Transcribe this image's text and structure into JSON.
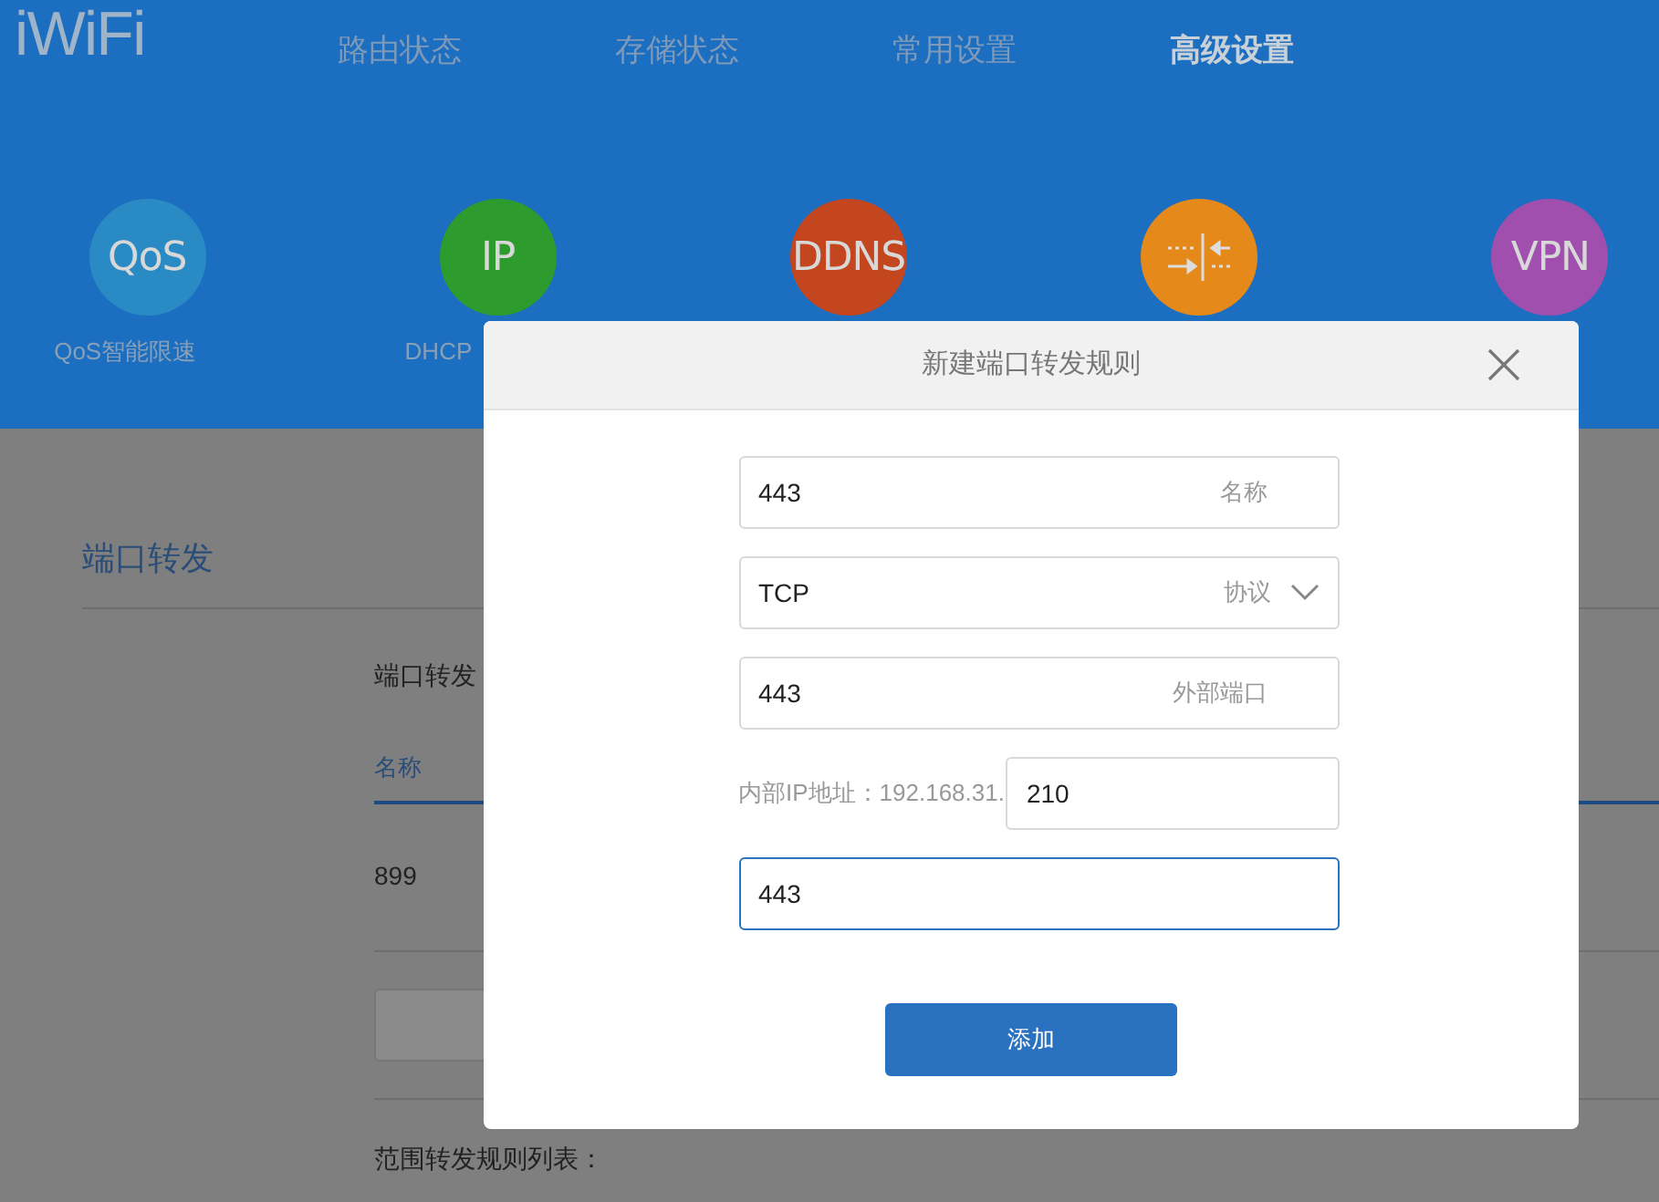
{
  "logo": "iWiFi",
  "nav": [
    {
      "label": "路由状态",
      "selected": false
    },
    {
      "label": "存储状态",
      "selected": false
    },
    {
      "label": "常用设置",
      "selected": false
    },
    {
      "label": "高级设置",
      "selected": true
    }
  ],
  "features": [
    {
      "kind": "text",
      "icon_text": "QoS",
      "label": "QoS智能限速",
      "color": "#2a8ac4"
    },
    {
      "kind": "text",
      "icon_text": "IP",
      "label": "DHCP",
      "color": "#2e9b2f"
    },
    {
      "kind": "text",
      "icon_text": "DDNS",
      "color": "#c4461f"
    },
    {
      "kind": "arrows",
      "color": "#e5891a"
    },
    {
      "kind": "text",
      "icon_text": "VPN",
      "color": "#a14fae"
    }
  ],
  "section": {
    "title": "端口转发",
    "subtitle": "端口转发",
    "column_1": "名称",
    "rows": [
      {
        "name": "899"
      }
    ],
    "range_title": "范围转发规则列表："
  },
  "dialog": {
    "title": "新建端口转发规则",
    "fields": [
      {
        "kind": "text",
        "value": "443",
        "label": "名称",
        "focused": false
      },
      {
        "kind": "select",
        "value": "TCP",
        "label": "协议",
        "focused": false
      },
      {
        "kind": "text",
        "value": "443",
        "label": "外部端口",
        "focused": false
      },
      {
        "kind": "ip",
        "prefix": "内部IP地址：192.168.31.",
        "value": "210",
        "focused": false
      },
      {
        "kind": "text",
        "value": "443",
        "focused": true
      }
    ],
    "button": "添加"
  }
}
